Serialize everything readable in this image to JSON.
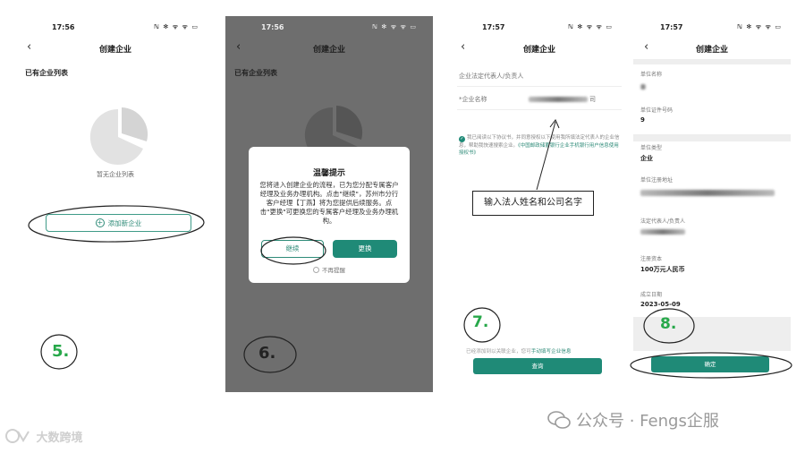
{
  "status": {
    "time1": "17:56",
    "time2": "17:56",
    "time3": "17:57",
    "time4": "17:57",
    "icons": "ℕ ✻ ᯤ ᯤ ▭"
  },
  "nav": {
    "back": "‹",
    "title": "创建企业"
  },
  "screen1": {
    "list_heading": "已有企业列表",
    "empty_text": "暂无企业列表",
    "add_button": "添加新企业",
    "step_label": "5."
  },
  "screen2": {
    "list_heading": "已有企业列表",
    "dialog_title": "温馨提示",
    "dialog_body": "您将进入创建企业的流程，已为您分配专属客户经理及业务办理机构。点击\"继续\"，苏州市分行客户经理【丁燕】将为您提供后续服务。点击\"更换\"可更换您的专属客户经理及业务办理机构。",
    "continue_button": "继续",
    "change_button": "更换",
    "no_remind": "不再提醒",
    "step_label": "6."
  },
  "screen3": {
    "field_legal": "企业法定代表人/负责人",
    "field_company_prefix": "*企业名称",
    "field_company_suffix": "司",
    "agreement": "我已阅读以下协议书，并同意授权以下使用我所填法定代表人的企业信息，帮助我快速搜索企业。",
    "agreement_link": "《中国邮政储蓄银行企业手机银行用户信息使用授权书》",
    "callout": "输入法人姓名和公司名字",
    "foot_note": "已经添加到以关联企业，您可",
    "foot_link": "手动填写企业信息",
    "query_button": "查询",
    "step_label": "7."
  },
  "screen4": {
    "rows": [
      {
        "label": "单位名称",
        "value": ""
      },
      {
        "label": "单位证件号码",
        "value": "9"
      },
      {
        "label": "单位类型",
        "value": "企业"
      },
      {
        "label": "单位注册地址",
        "value": ""
      },
      {
        "label": "法定代表人/负责人",
        "value": ""
      },
      {
        "label": "注册资本",
        "value": "100万元人民币"
      },
      {
        "label": "成立日期",
        "value": "2023-05-09"
      }
    ],
    "confirm_button": "确定",
    "step_label": "8."
  },
  "watermarks": {
    "left": "大数跨境",
    "right": "公众号 · Fengs企服"
  },
  "colors": {
    "accent": "#1f8a77",
    "step_green": "#27a84a",
    "overlay": "#6e6e6e"
  }
}
